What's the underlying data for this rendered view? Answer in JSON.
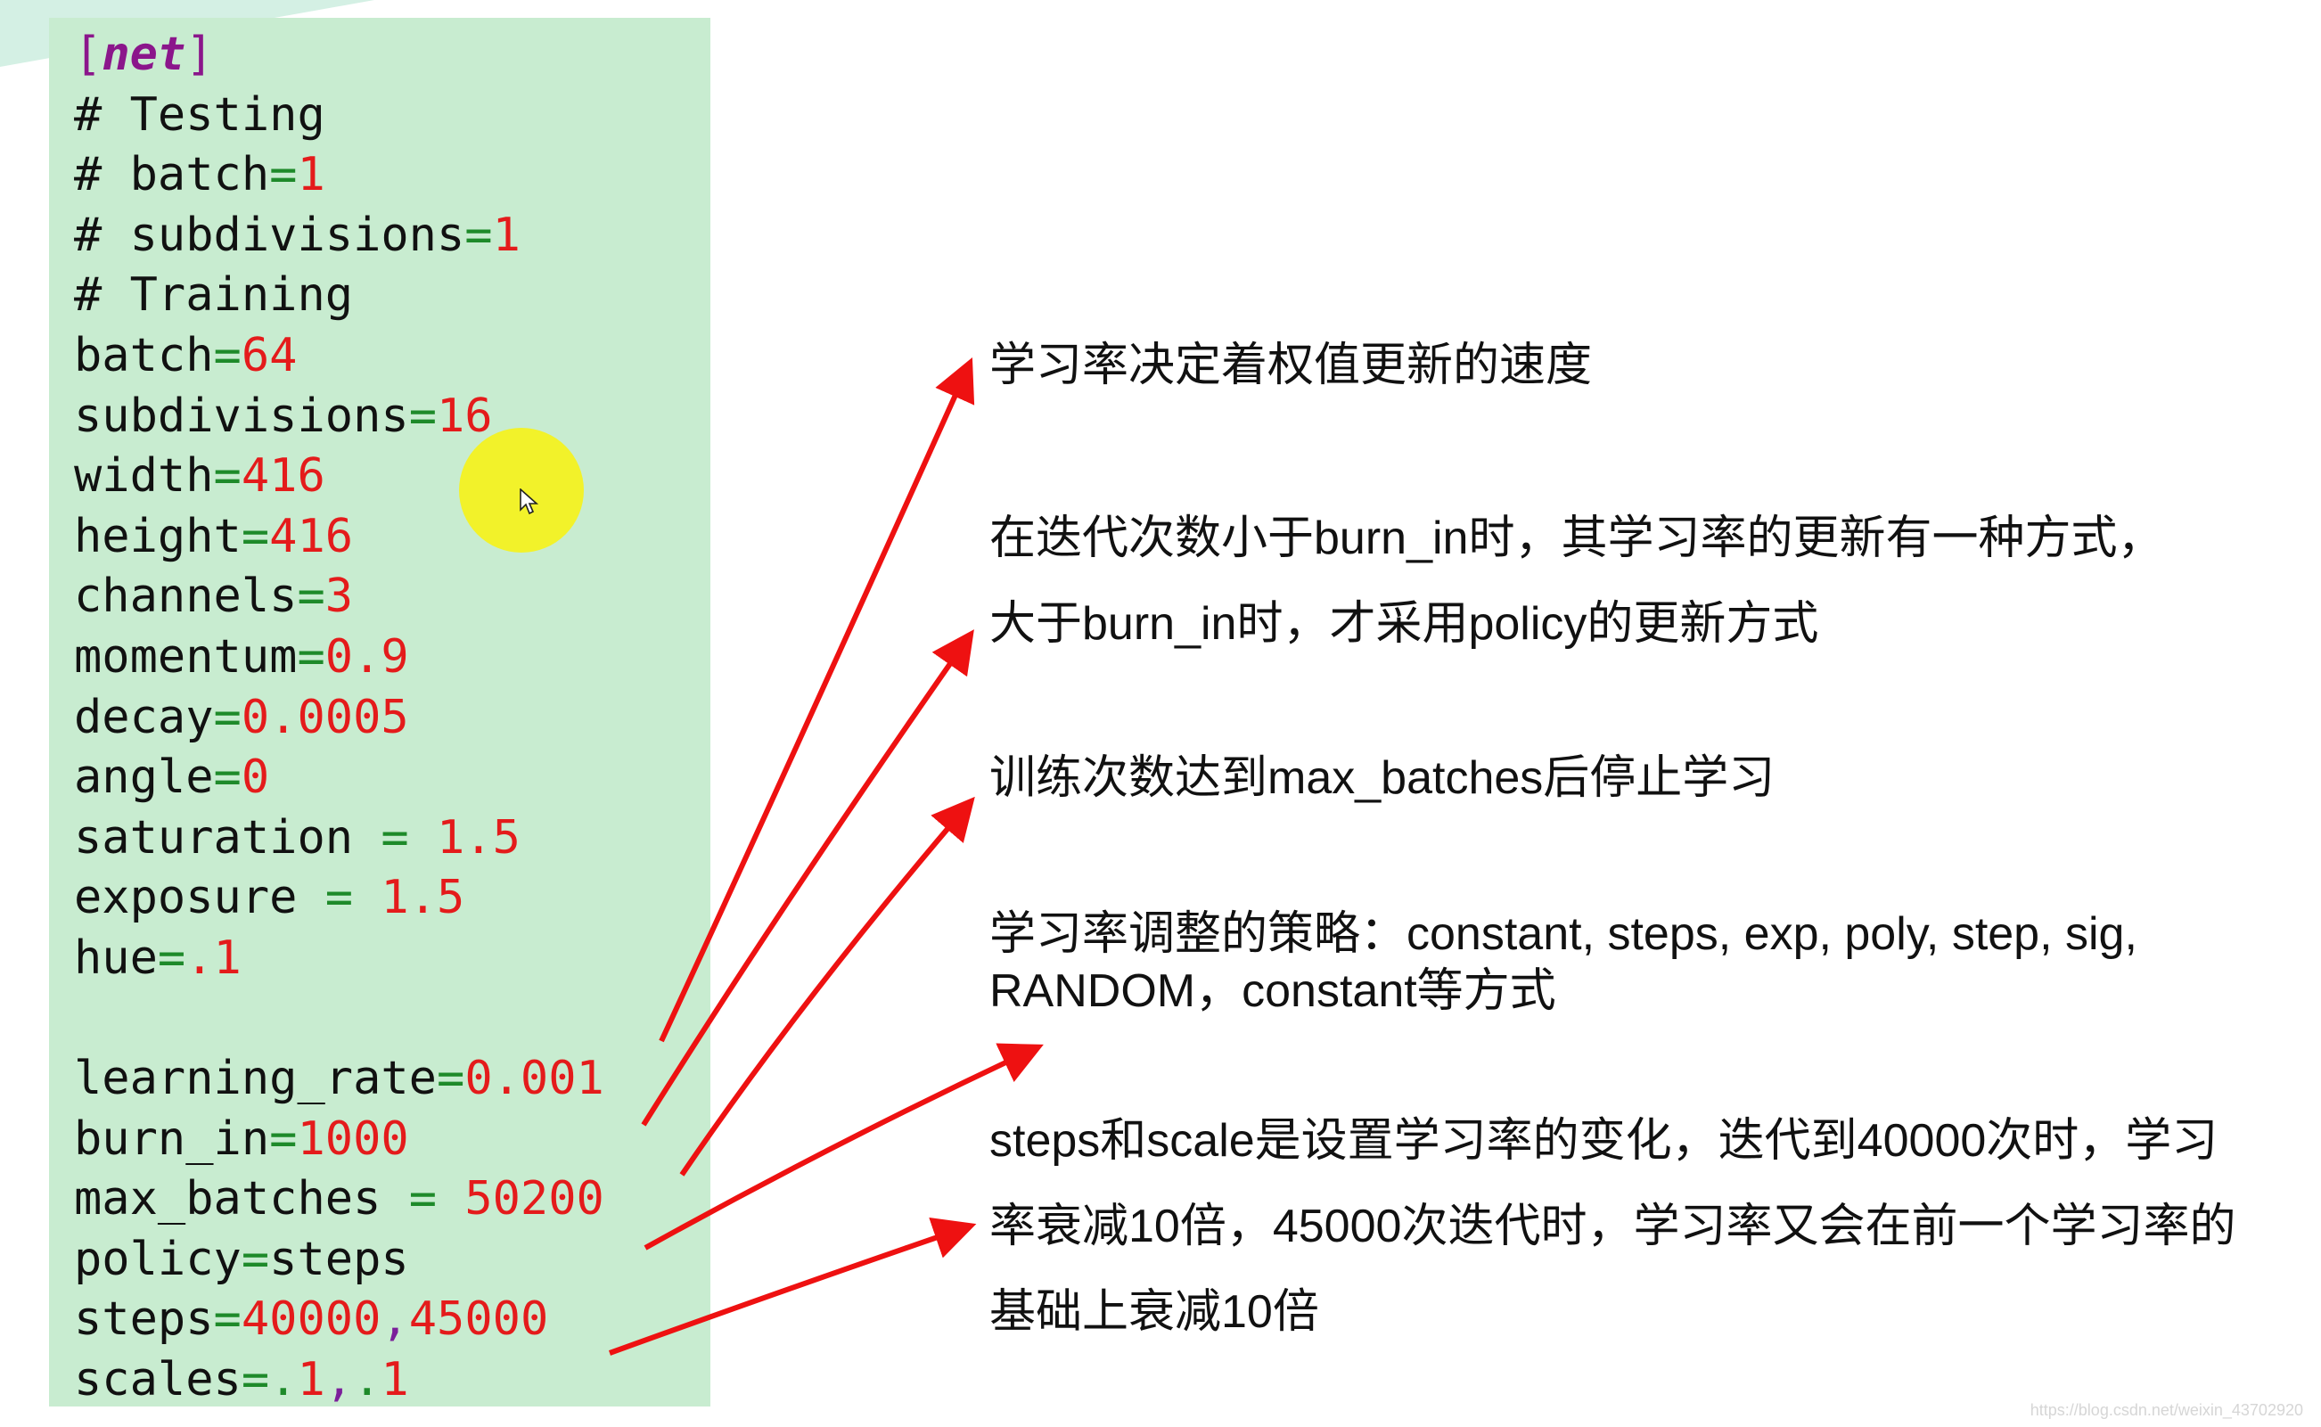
{
  "config": {
    "section": {
      "open": "[",
      "name": "net",
      "close": "]"
    },
    "lines": [
      {
        "type": "section"
      },
      {
        "type": "comment",
        "text": "# Testing"
      },
      {
        "type": "comment-kv",
        "key": "# batch",
        "eq": "=",
        "value": "1"
      },
      {
        "type": "comment-kv",
        "key": "# subdivisions",
        "eq": "=",
        "value": "1"
      },
      {
        "type": "comment",
        "text": "# Training"
      },
      {
        "type": "kv",
        "key": "batch",
        "eq": "=",
        "value": "64"
      },
      {
        "type": "kv",
        "key": "subdivisions",
        "eq": "=",
        "value": "16"
      },
      {
        "type": "kv",
        "key": "width",
        "eq": "=",
        "value": "416"
      },
      {
        "type": "kv",
        "key": "height",
        "eq": "=",
        "value": "416"
      },
      {
        "type": "kv",
        "key": "channels",
        "eq": "=",
        "value": "3"
      },
      {
        "type": "kv",
        "key": "momentum",
        "eq": "=",
        "value": "0.9"
      },
      {
        "type": "kv",
        "key": "decay",
        "eq": "=",
        "value": "0.0005"
      },
      {
        "type": "kv",
        "key": "angle",
        "eq": "=",
        "value": "0"
      },
      {
        "type": "kv",
        "key": "saturation ",
        "eq": "= ",
        "value": "1.5"
      },
      {
        "type": "kv",
        "key": "exposure ",
        "eq": "= ",
        "value": "1.5"
      },
      {
        "type": "kv",
        "key": "hue",
        "eq": "=",
        "value": ".1"
      },
      {
        "type": "blank"
      },
      {
        "type": "kv",
        "key": "learning_rate",
        "eq": "=",
        "value": "0.001"
      },
      {
        "type": "kv",
        "key": "burn_in",
        "eq": "=",
        "value": "1000"
      },
      {
        "type": "kv",
        "key": "max_batches ",
        "eq": "= ",
        "value": "50200"
      },
      {
        "type": "kv-plain",
        "key": "policy",
        "eq": "=",
        "value": "steps"
      },
      {
        "type": "kv-list",
        "key": "steps",
        "eq": "=",
        "values": [
          "40000",
          "45000"
        ]
      },
      {
        "type": "kv-list",
        "key": "scales",
        "eq": "=",
        "values": [
          ".1",
          ".1"
        ]
      }
    ]
  },
  "annotations": [
    {
      "id": "learning-rate",
      "lines": [
        "学习率决定着权值更新的速度"
      ]
    },
    {
      "id": "burn-in",
      "lines": [
        "在迭代次数小于burn_in时，其学习率的更新有一种方式，",
        "大于burn_in时，才采用policy的更新方式"
      ]
    },
    {
      "id": "max-batches",
      "lines": [
        "训练次数达到max_batches后停止学习"
      ]
    },
    {
      "id": "policy",
      "lines": [
        "学习率调整的策略：constant, steps, exp, poly, step, sig,",
        "RANDOM，constant等方式"
      ]
    },
    {
      "id": "steps-scales",
      "lines": [
        "steps和scale是设置学习率的变化，迭代到40000次时，学习",
        "率衰减10倍，45000次迭代时，学习率又会在前一个学习率的",
        "基础上衰减10倍"
      ]
    }
  ],
  "colors": {
    "panel_bg": "#c8ecd0",
    "key": "#111111",
    "equals": "#1e8a2a",
    "value": "#e41b1b",
    "section": "#8b168b",
    "arrow": "#ee1111",
    "cursor_highlight": "#f2f22a"
  },
  "cursor": {
    "icon": "arrow-pointer-icon"
  },
  "watermark": "https://blog.csdn.net/weixin_43702920"
}
